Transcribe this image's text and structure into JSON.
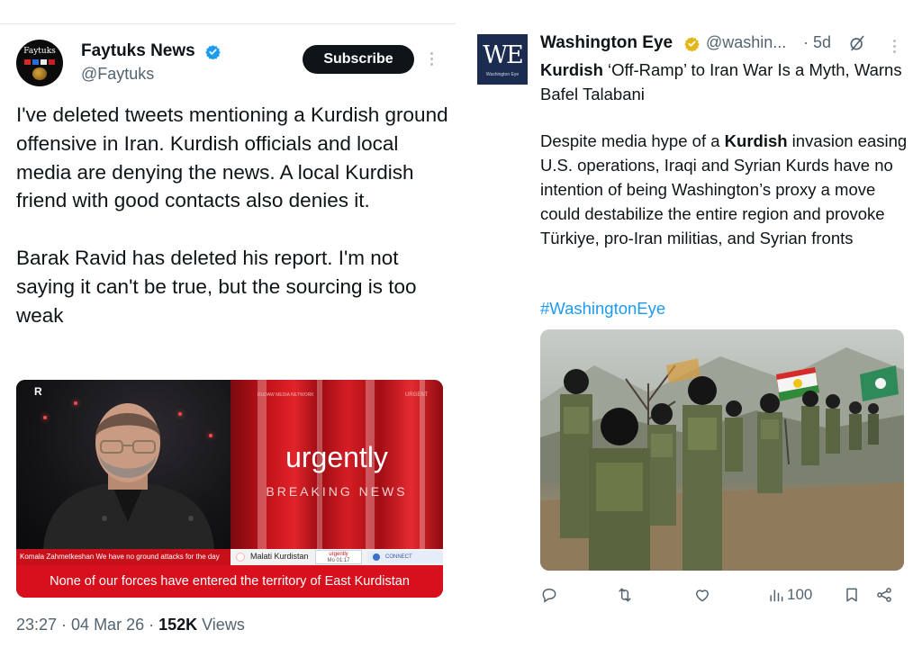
{
  "left_tweet": {
    "author_name": "Faytuks News",
    "handle": "@Faytuks",
    "avatar_text": "Faytuks",
    "subscribe_label": "Subscribe",
    "paragraph_1": "I've deleted tweets mentioning a Kurdish ground offensive in Iran. Kurdish officials and local media are denying the news. A local Kurdish friend with good contacts also denies it.",
    "paragraph_2": "Barak Ravid has deleted his report. I'm not saying it can't be true, but the sourcing is too weak",
    "video": {
      "main_title": "urgently",
      "sub_title": "BREAKING NEWS",
      "corner_tag": "URGENT",
      "network_tag": "RUDAW MEDIA NETWORK",
      "logo_text": "R",
      "ticker_left": "Komala Zahmetkeshan We have no ground attacks for the day",
      "ticker_right": "Malati Kurdistan",
      "ticker_pill_1": "urgently",
      "ticker_pill_2": "Mo 01:17",
      "ticker_connect": "CONNECT",
      "caption": "None of our forces have entered the territory of East Kurdistan"
    },
    "time": "23:27 · 04 Mar 26 · ",
    "views_count": "152K",
    "views_label": " Views"
  },
  "right_tweet": {
    "logo_text": "WE",
    "logo_subtext": "Washington Eye",
    "author_name": "Washington Eye",
    "handle": "@washin...",
    "time": "· 5d",
    "headline_bold": "Kurdish",
    "headline_rest": " ‘Off-Ramp’ to Iran War Is a Myth, Warns Bafel Talabani",
    "body_pre": "Despite media hype of a ",
    "body_bold": "Kurdish",
    "body_post": " invasion easing U.S. operations, Iraqi and Syrian Kurds have no intention of being Washington’s proxy a move could destabilize the entire region and provoke Türkiye, pro-Iran militias, and Syrian fronts",
    "hashtag": "#WashingtonEye",
    "views": "100"
  },
  "colors": {
    "verified_blue": "#1d9bf0",
    "gold_badge": "#e2b719",
    "news_red": "#d80f1c",
    "muted": "#536471"
  },
  "icons": [
    "verified-icon",
    "gold-verified-icon",
    "grok-icon",
    "more-icon",
    "reply-icon",
    "retweet-icon",
    "like-icon",
    "views-icon",
    "bookmark-icon",
    "share-icon"
  ]
}
